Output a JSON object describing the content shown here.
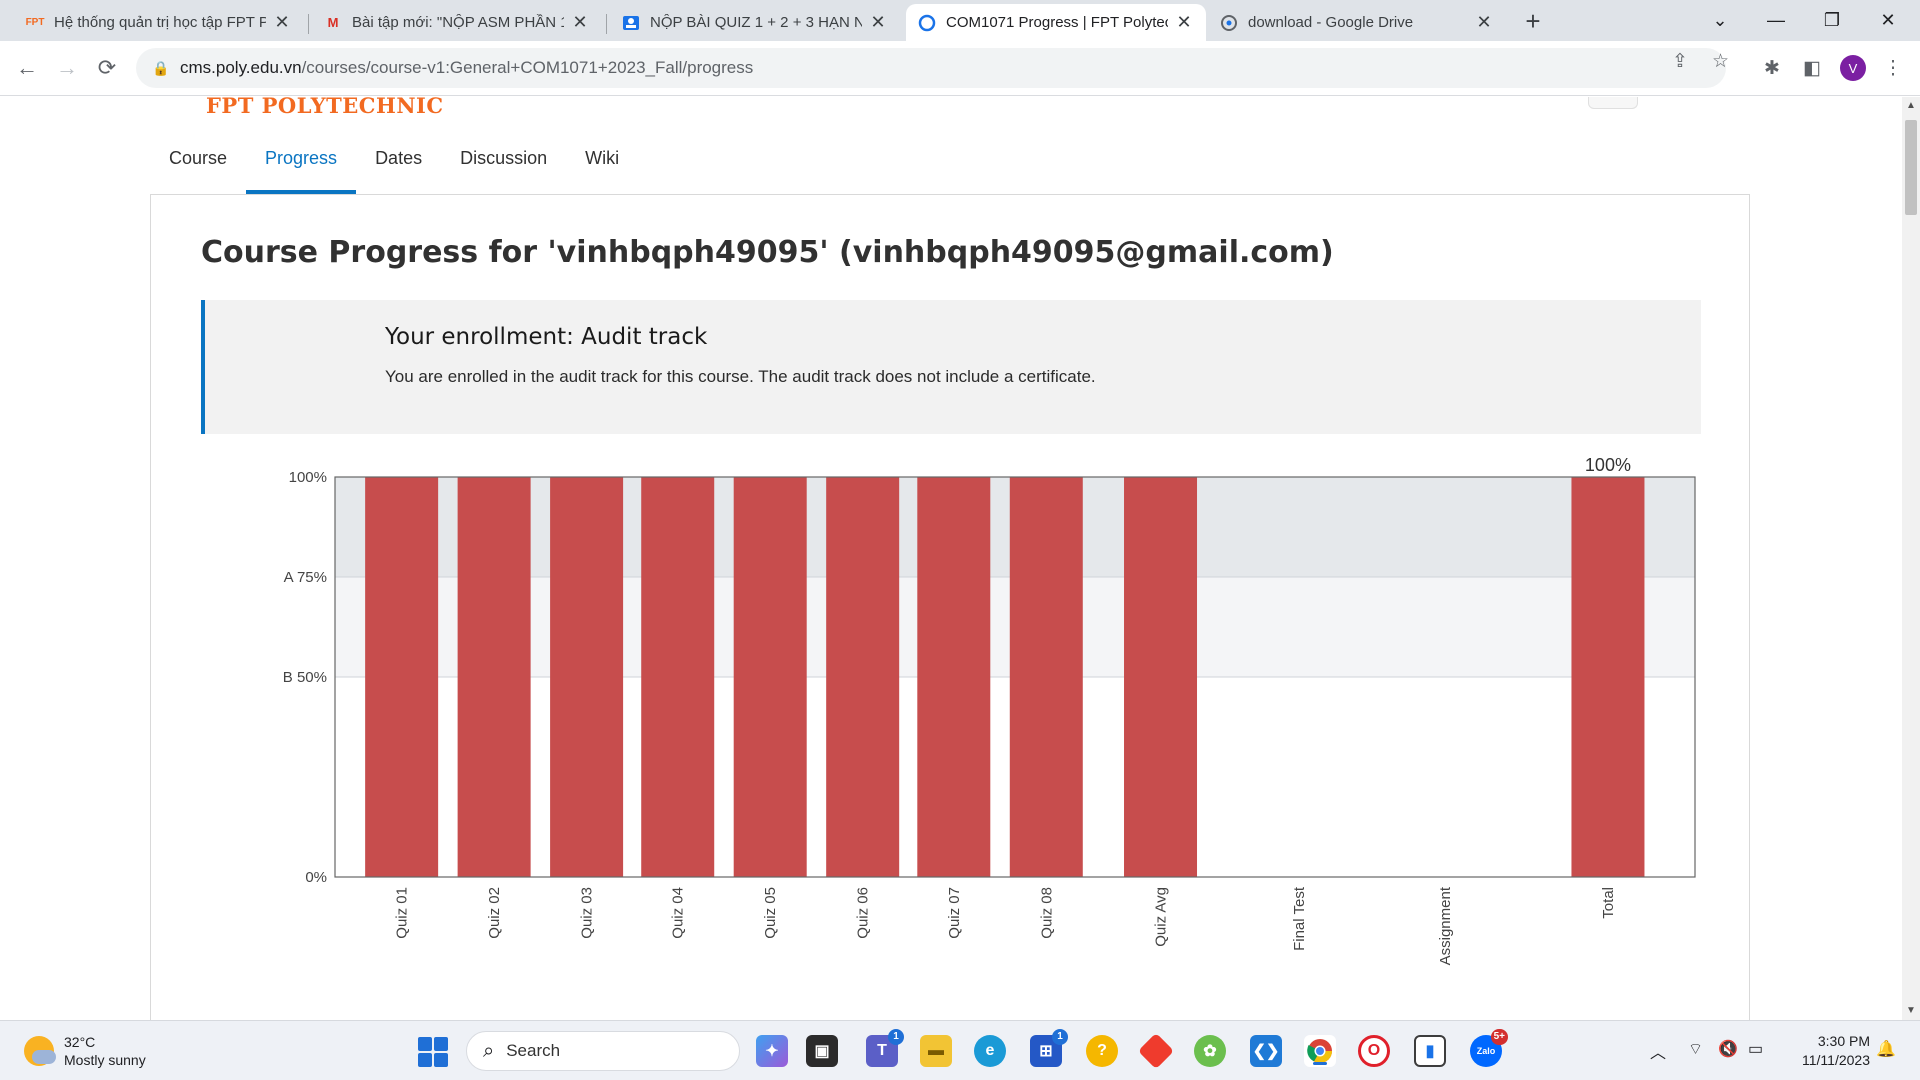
{
  "browser": {
    "tabs": [
      {
        "title": "Hệ thống quản trị học tập FPT P",
        "icon": "fpt-logo-icon",
        "active": false
      },
      {
        "title": "Bài tập mới: \"NỘP ASM PHẦN 1",
        "icon": "gmail-icon",
        "active": false
      },
      {
        "title": "NỘP BÀI QUIZ 1 + 2 + 3 HẠN N",
        "icon": "classroom-icon",
        "active": false
      },
      {
        "title": "COM1071 Progress | FPT Polytec",
        "icon": "loading-icon",
        "active": true
      },
      {
        "title": "download - Google Drive",
        "icon": "drive-icon",
        "active": false
      }
    ],
    "url_host": "cms.poly.edu.vn",
    "url_path": "/courses/course-v1:General+COM1071+2023_Fall/progress",
    "profile_initial": "V"
  },
  "page": {
    "logo": "FPT POLYTECHNIC",
    "nav": [
      "Course",
      "Progress",
      "Dates",
      "Discussion",
      "Wiki"
    ],
    "active_nav": "Progress",
    "heading": "Course Progress for 'vinhbqph49095' (vinhbqph49095@gmail.com)",
    "enrollment_title": "Your enrollment: Audit track",
    "enrollment_text": "You are enrolled in the audit track for this course. The audit track does not include a certificate."
  },
  "chart_data": {
    "type": "bar",
    "categories": [
      "Quiz 01",
      "Quiz 02",
      "Quiz 03",
      "Quiz 04",
      "Quiz 05",
      "Quiz 06",
      "Quiz 07",
      "Quiz 08",
      "Quiz Avg",
      "Final Test",
      "Assignment",
      "Total"
    ],
    "values": [
      100,
      100,
      100,
      100,
      100,
      100,
      100,
      100,
      100,
      0,
      0,
      100
    ],
    "yticks": [
      {
        "value": 100,
        "label": "100%"
      },
      {
        "value": 75,
        "label": "A 75%"
      },
      {
        "value": 50,
        "label": "B 50%"
      },
      {
        "value": 0,
        "label": "0%"
      }
    ],
    "ylim": [
      0,
      100
    ],
    "total_label": "100%",
    "bar_color": "#c74d4d",
    "band_colors": [
      "#e5e8eb",
      "#f4f5f7"
    ]
  },
  "taskbar": {
    "temperature": "32°C",
    "weather": "Mostly sunny",
    "search_placeholder": "Search",
    "time": "3:30 PM",
    "date": "11/11/2023",
    "badges": {
      "teams": "1",
      "store": "1",
      "zalo": "5+"
    }
  }
}
